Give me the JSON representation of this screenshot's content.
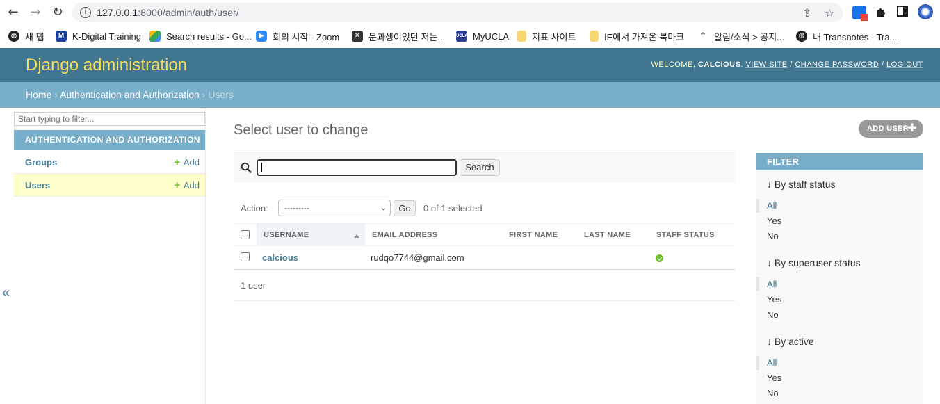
{
  "browser": {
    "url_host": "127.0.0.1",
    "url_rest": ":8000/admin/auth/user/",
    "bookmarks": [
      {
        "label": "새 탭",
        "icon": "globe-icon"
      },
      {
        "label": "K-Digital Training",
        "icon": "k-digital-logo-icon"
      },
      {
        "label": "Search results - Go...",
        "icon": "google-drive-icon"
      },
      {
        "label": "회의 시작 - Zoom",
        "icon": "zoom-icon"
      },
      {
        "label": "문과생이었던 저는...",
        "icon": "blog-icon"
      },
      {
        "label": "MyUCLA",
        "icon": "ucla-icon"
      },
      {
        "label": "지표 사이트",
        "icon": "folder-icon"
      },
      {
        "label": "IE에서 가져온 북마크",
        "icon": "folder-icon"
      },
      {
        "label": "알림/소식 > 공지...",
        "icon": "notice-icon"
      },
      {
        "label": "내 Transnotes - Tra...",
        "icon": "globe-icon"
      }
    ]
  },
  "header": {
    "branding": "Django administration",
    "welcome": "Welcome,",
    "username": "calcious",
    "view_site": "View site",
    "change_password": "Change password",
    "log_out": "Log out",
    "sep": " / "
  },
  "breadcrumbs": {
    "home": "Home",
    "app": "Authentication and Authorization",
    "current": "Users",
    "sep": " › "
  },
  "sidebar": {
    "filter_placeholder": "Start typing to filter...",
    "app_caption": "AUTHENTICATION AND AUTHORIZATION",
    "models": [
      {
        "name": "Groups",
        "add": "Add"
      },
      {
        "name": "Users",
        "add": "Add"
      }
    ],
    "collapse": "«"
  },
  "main": {
    "title": "Select user to change",
    "add_button": "ADD USER",
    "search_button": "Search",
    "action_label": "Action:",
    "action_selected": "---------",
    "go_button": "Go",
    "selection_count": "0 of 1 selected",
    "columns": [
      "USERNAME",
      "EMAIL ADDRESS",
      "FIRST NAME",
      "LAST NAME",
      "STAFF STATUS"
    ],
    "rows": [
      {
        "username": "calcious",
        "email": "rudqo7744@gmail.com",
        "first_name": "",
        "last_name": "",
        "staff_status": true
      }
    ],
    "paginator": "1 user"
  },
  "filter": {
    "heading": "FILTER",
    "groups": [
      {
        "title": "↓ By staff status",
        "options": [
          "All",
          "Yes",
          "No"
        ]
      },
      {
        "title": "↓ By superuser status",
        "options": [
          "All",
          "Yes",
          "No"
        ]
      },
      {
        "title": "↓ By active",
        "options": [
          "All",
          "Yes",
          "No"
        ]
      }
    ]
  }
}
